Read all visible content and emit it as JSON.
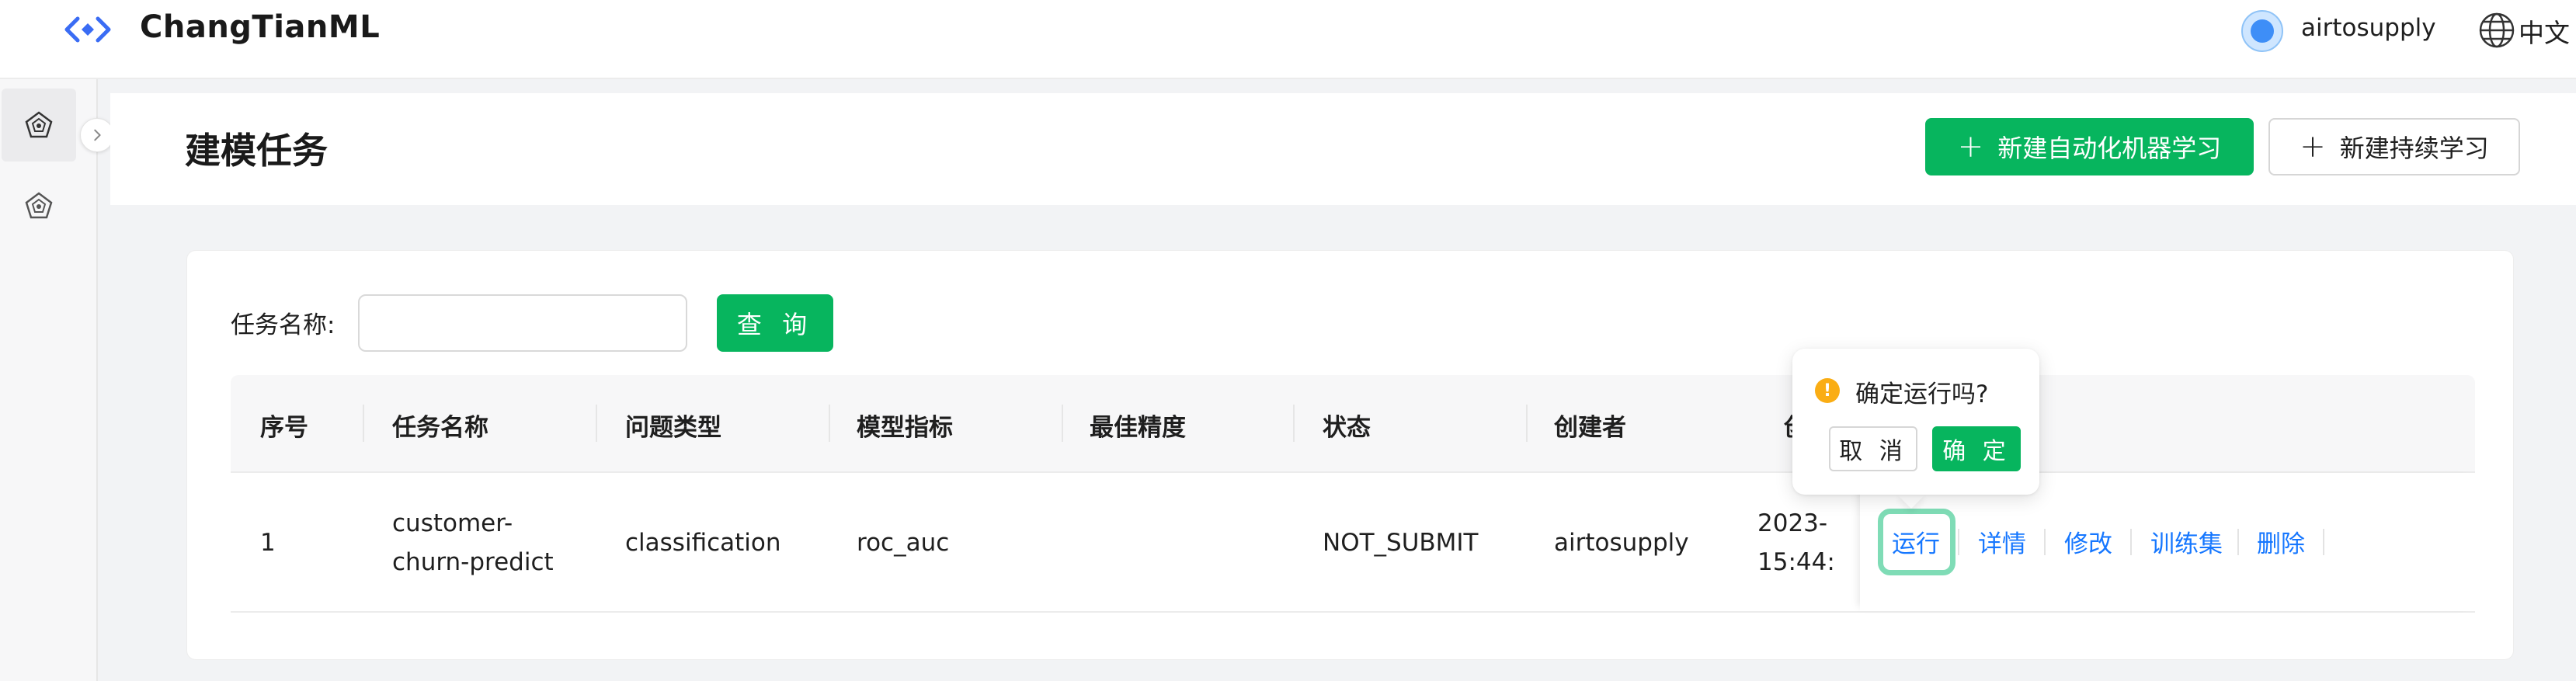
{
  "header": {
    "brand": "ChangTianML",
    "username": "airtosupply",
    "language": "中文"
  },
  "page": {
    "title": "建模任务",
    "new_automl_label": "新建自动化机器学习",
    "new_continual_label": "新建持续学习"
  },
  "search": {
    "label": "任务名称:",
    "value": "",
    "placeholder": "",
    "query_label": "查 询"
  },
  "table": {
    "columns": [
      "序号",
      "任务名称",
      "问题类型",
      "模型指标",
      "最佳精度",
      "状态",
      "创建者",
      "创"
    ],
    "rows": [
      {
        "index": "1",
        "name_line1": "customer-",
        "name_line2": "churn-predict",
        "problem_type": "classification",
        "metric": "roc_auc",
        "best_accuracy": "",
        "status": "NOT_SUBMIT",
        "creator": "airtosupply",
        "created_line1": "2023-",
        "created_line2": "15:44:",
        "actions": [
          "运行",
          "详情",
          "修改",
          "训练集",
          "删除"
        ]
      }
    ]
  },
  "popconfirm": {
    "message": "确定运行吗?",
    "cancel_label": "取 消",
    "ok_label": "确 定"
  },
  "colors": {
    "primary": "#07b55e",
    "link": "#1677ff",
    "warning": "#faad14"
  }
}
